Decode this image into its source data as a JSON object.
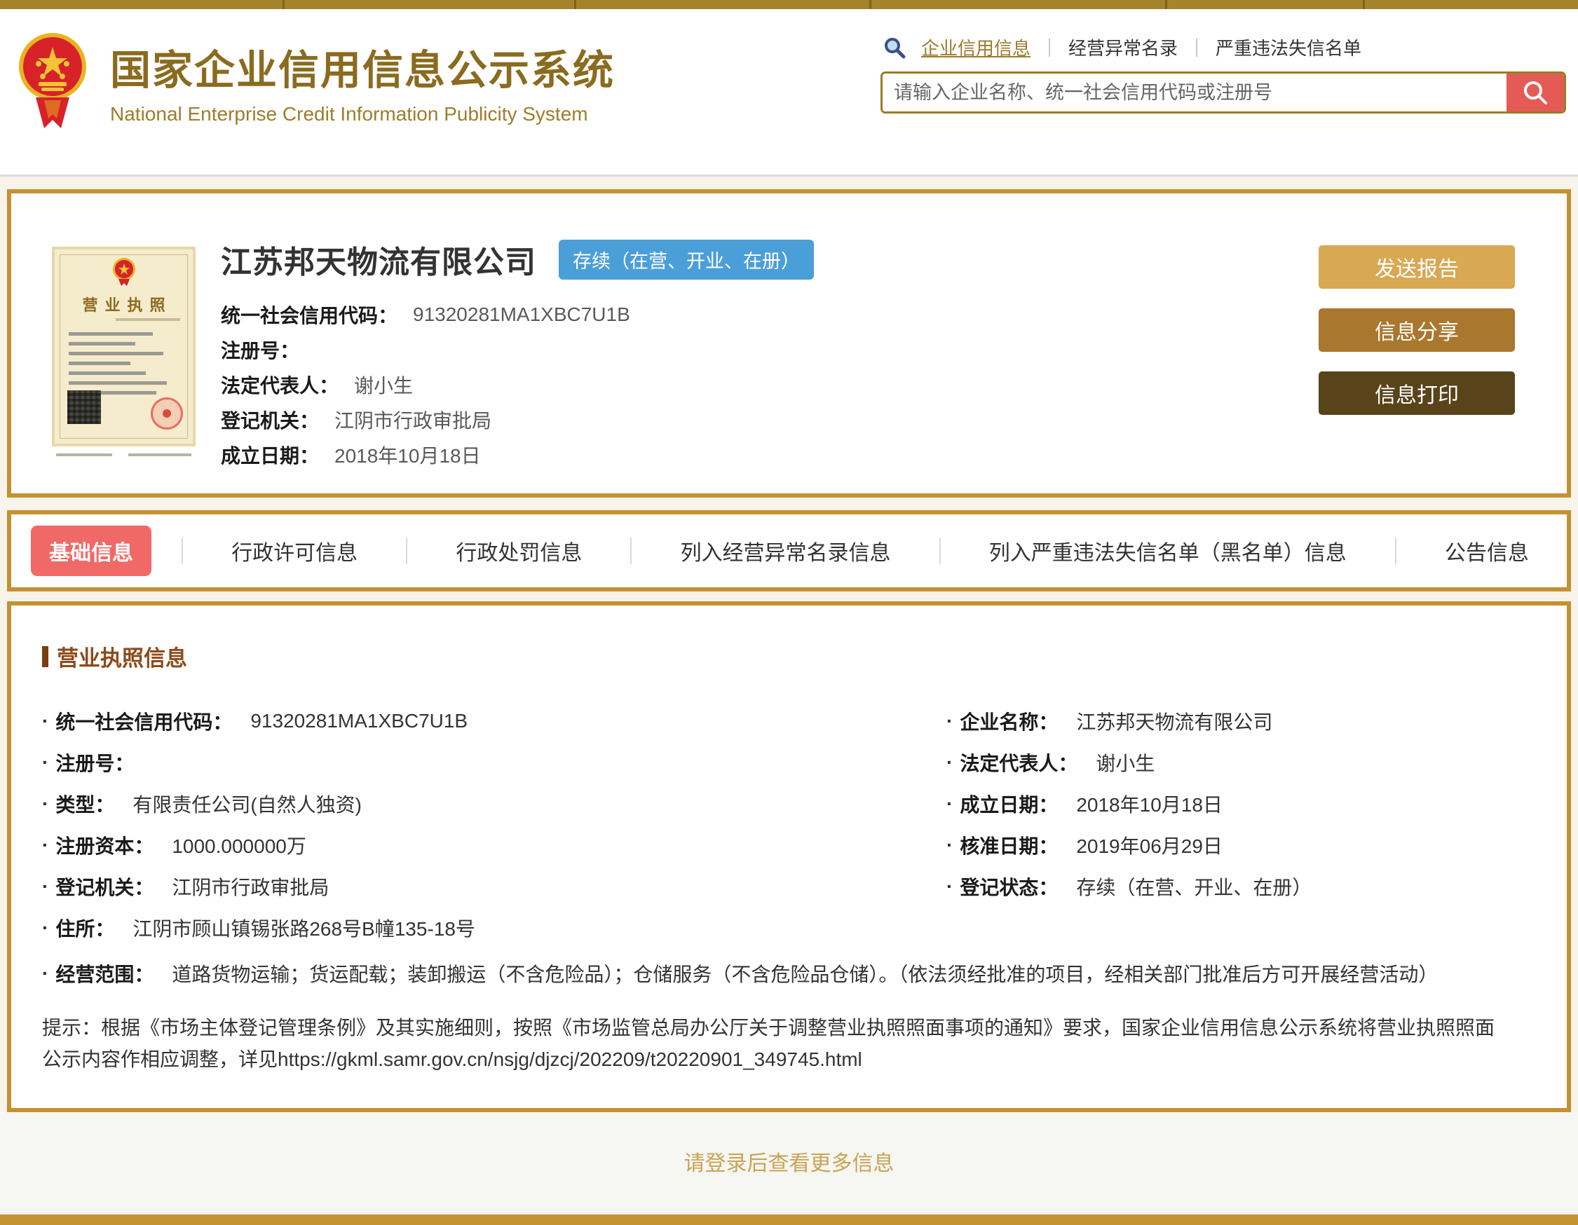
{
  "header": {
    "title": "国家企业信用信息公示系统",
    "subtitle": "National Enterprise Credit Information Publicity System",
    "nav": {
      "link1": "企业信用信息",
      "link2": "经营异常名录",
      "link3": "严重违法失信名单"
    },
    "search_placeholder": "请输入企业名称、统一社会信用代码或注册号"
  },
  "company": {
    "name": "江苏邦天物流有限公司",
    "status": "存续（在营、开业、在册）",
    "license_thumb_title": "营业执照",
    "fields": [
      {
        "label": "统一社会信用代码：",
        "value": "91320281MA1XBC7U1B"
      },
      {
        "label": "注册号：",
        "value": ""
      },
      {
        "label": "法定代表人：",
        "value": "谢小生"
      },
      {
        "label": "登记机关：",
        "value": "江阴市行政审批局"
      },
      {
        "label": "成立日期：",
        "value": "2018年10月18日"
      }
    ],
    "actions": [
      "发送报告",
      "信息分享",
      "信息打印"
    ]
  },
  "tabs": [
    "基础信息",
    "行政许可信息",
    "行政处罚信息",
    "列入经营异常名录信息",
    "列入严重违法失信名单（黑名单）信息",
    "公告信息"
  ],
  "license_info": {
    "section_title": "营业执照信息",
    "left": [
      {
        "label": "统一社会信用代码：",
        "value": "91320281MA1XBC7U1B"
      },
      {
        "label": "注册号：",
        "value": ""
      },
      {
        "label": "类型：",
        "value": "有限责任公司(自然人独资)"
      },
      {
        "label": "注册资本：",
        "value": "1000.000000万"
      },
      {
        "label": "登记机关：",
        "value": "江阴市行政审批局"
      },
      {
        "label": "住所：",
        "value": "江阴市顾山镇锡张路268号B幢135-18号"
      }
    ],
    "right": [
      {
        "label": "企业名称：",
        "value": "江苏邦天物流有限公司"
      },
      {
        "label": "法定代表人：",
        "value": "谢小生"
      },
      {
        "label": "成立日期：",
        "value": "2018年10月18日"
      },
      {
        "label": "核准日期：",
        "value": "2019年06月29日"
      },
      {
        "label": "登记状态：",
        "value": "存续（在营、开业、在册）"
      }
    ],
    "scope": {
      "label": "经营范围：",
      "value": "道路货物运输；货运配载；装卸搬运（不含危险品）；仓储服务（不含危险品仓储）。（依法须经批准的项目，经相关部门批准后方可开展经营活动）"
    },
    "note": "提示：根据《市场主体登记管理条例》及其实施细则，按照《市场监管总局办公厅关于调整营业执照照面事项的通知》要求，国家企业信用信息公示系统将营业执照照面公示内容作相应调整，详见https://gkml.samr.gov.cn/nsjg/djzcj/202209/t20220901_349745.html"
  },
  "footer": {
    "text": "请登录后查看更多信息"
  },
  "colors": {
    "accent_gold": "#C49231",
    "active_tab_red": "#F16966",
    "badge_blue": "#4B9FD8",
    "search_button_red": "#E45B55"
  }
}
